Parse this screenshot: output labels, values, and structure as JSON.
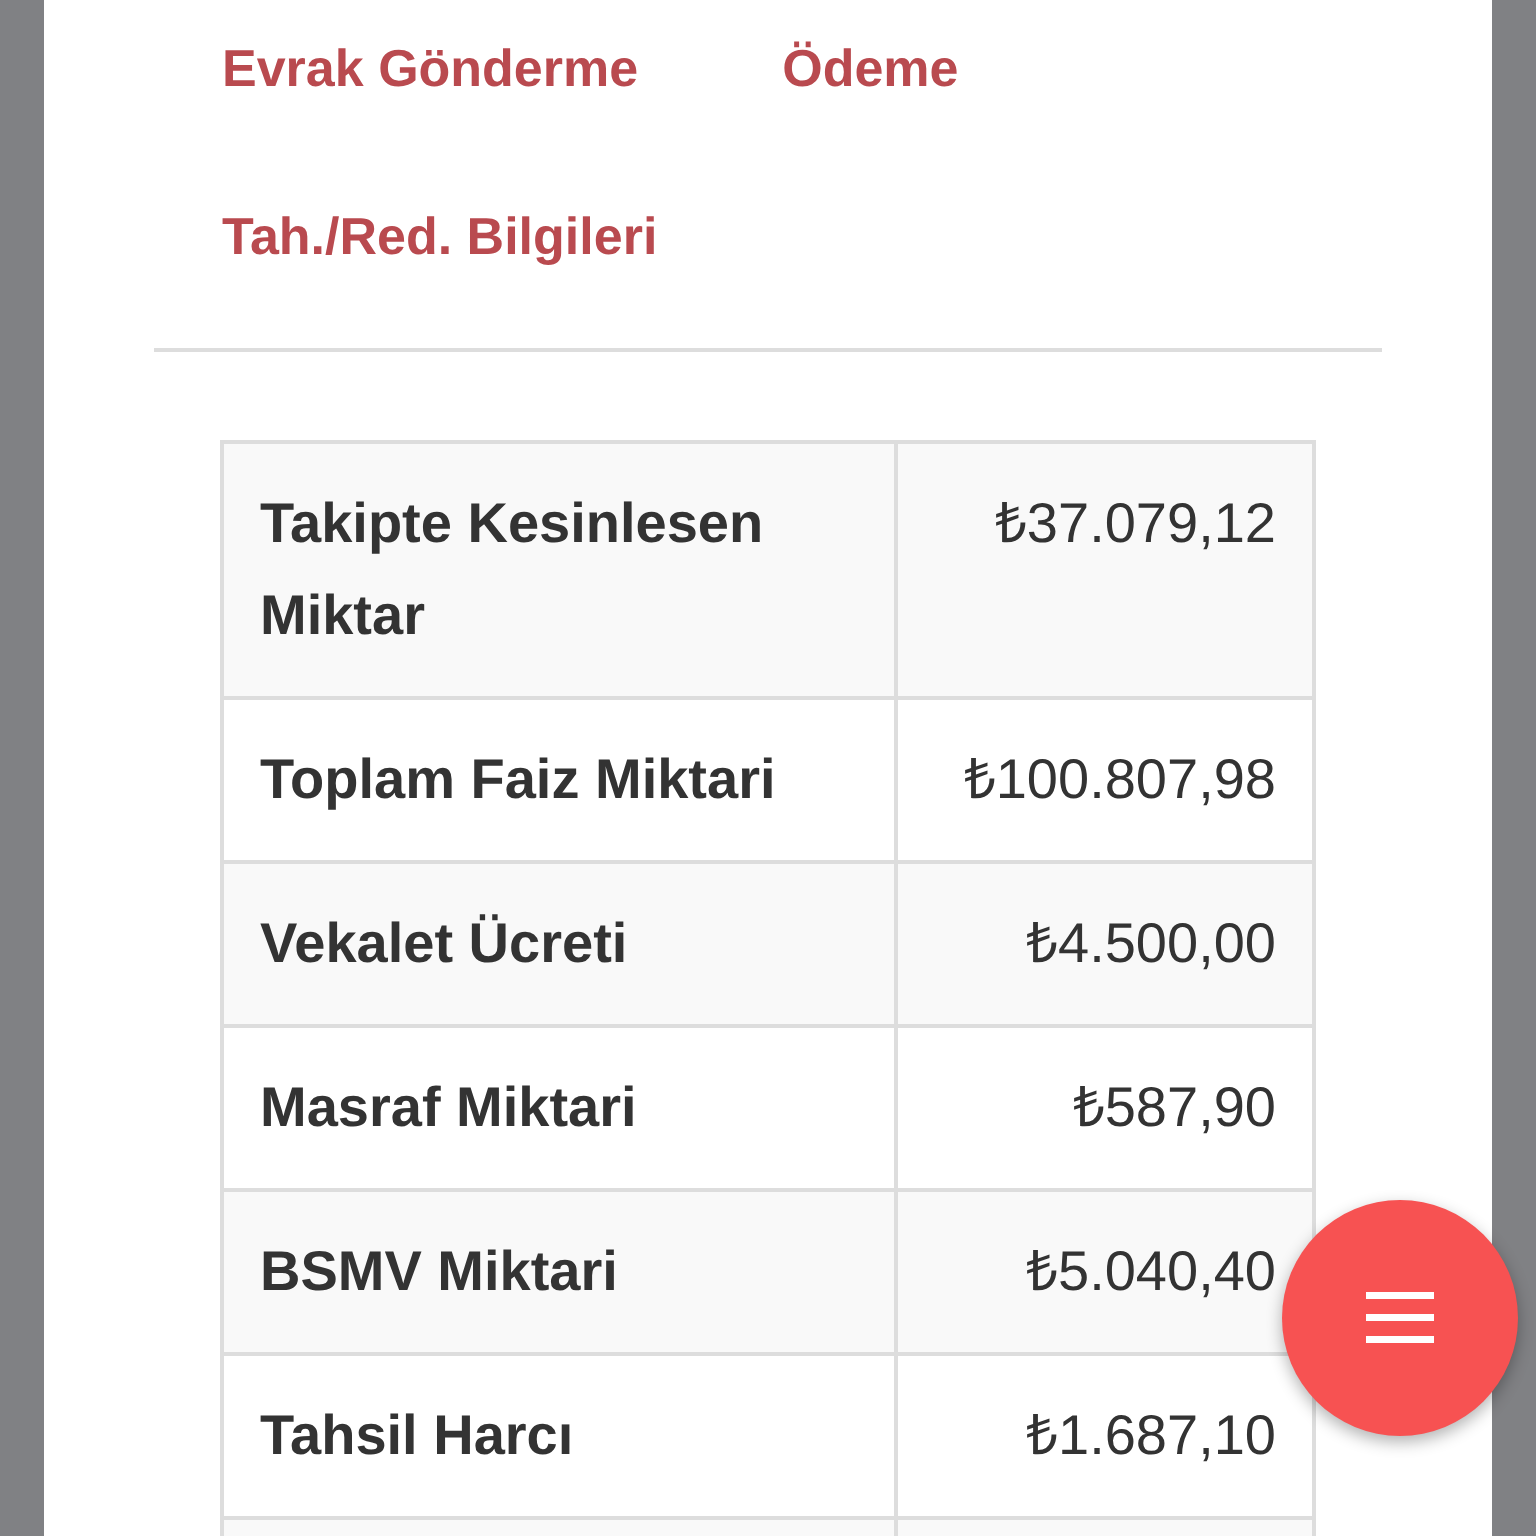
{
  "tabs": [
    {
      "label": "Evrak Gönderme"
    },
    {
      "label": "Ödeme"
    },
    {
      "label": "Tah./Red. Bilgileri"
    }
  ],
  "table": {
    "rows": [
      {
        "label": "Takipte Kesinlesen Miktar",
        "value": "₺37.079,12"
      },
      {
        "label": "Toplam Faiz Miktari",
        "value": "₺100.807,98"
      },
      {
        "label": "Vekalet Ücreti",
        "value": "₺4.500,00"
      },
      {
        "label": "Masraf Miktari",
        "value": "₺587,90"
      },
      {
        "label": "BSMV Miktari",
        "value": "₺5.040,40"
      },
      {
        "label": "Tahsil Harcı",
        "value": "₺1.687,10"
      }
    ]
  }
}
